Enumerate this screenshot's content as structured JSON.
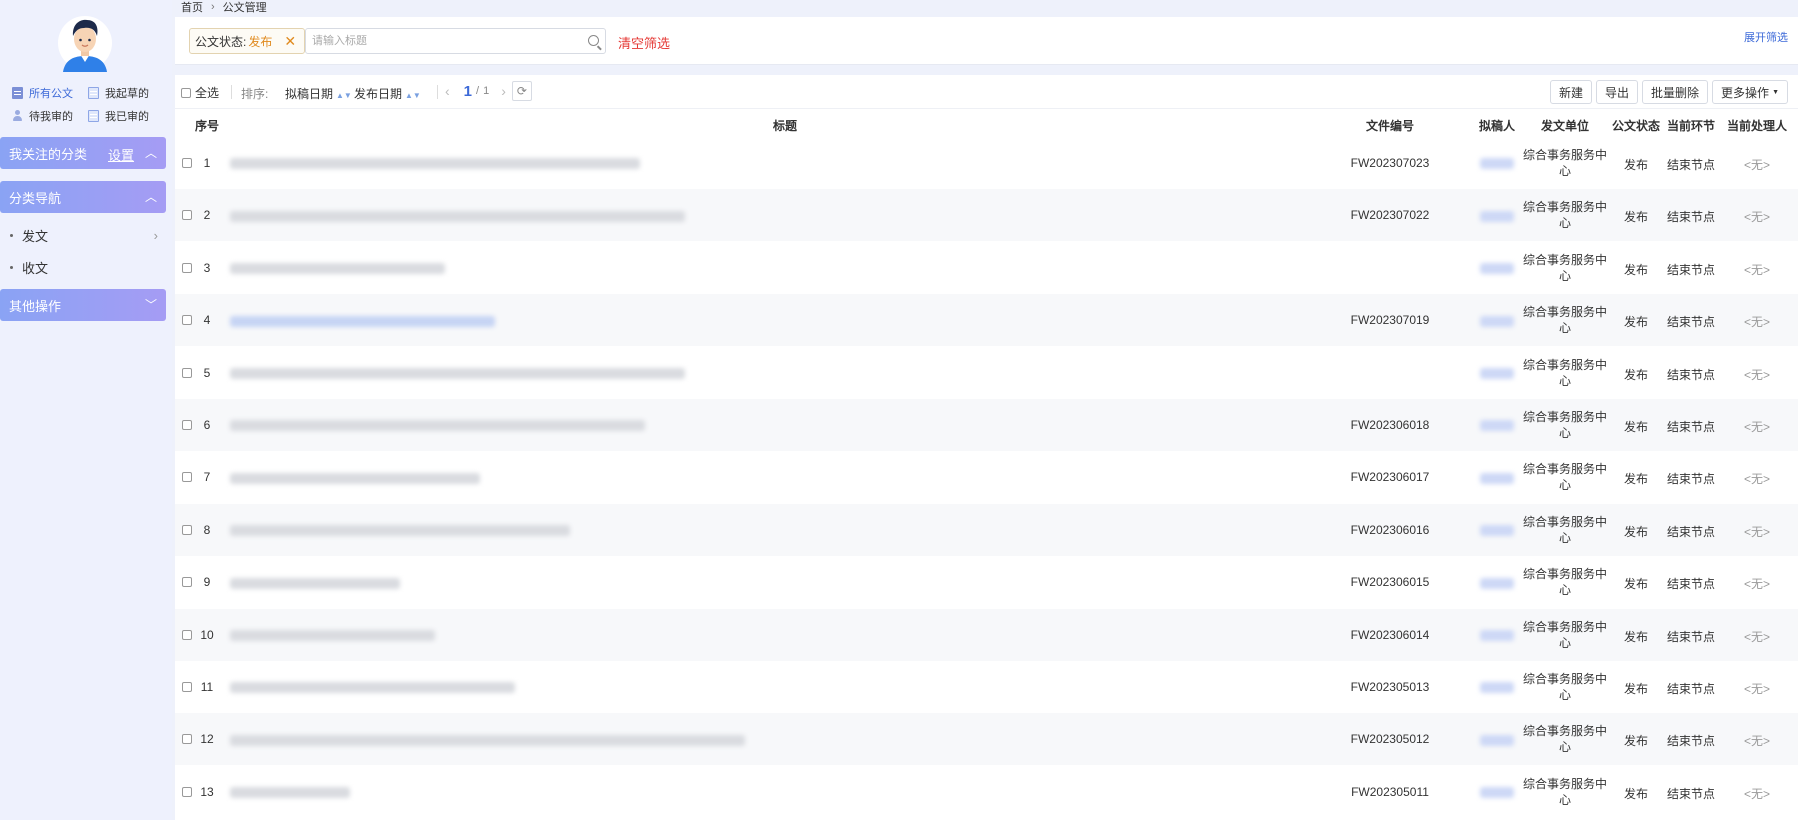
{
  "sidebar": {
    "quick_links": [
      {
        "label": "所有公文",
        "icon": "document-icon"
      },
      {
        "label": "我起草的",
        "icon": "document-icon"
      },
      {
        "label": "待我审的",
        "icon": "user-icon"
      },
      {
        "label": "我已审的",
        "icon": "document-icon"
      }
    ],
    "followed_section": {
      "label": "我关注的分类",
      "settings_label": "设置"
    },
    "category_section": {
      "label": "分类导航",
      "items": [
        {
          "label": "发文"
        },
        {
          "label": "收文"
        }
      ]
    },
    "other_section": {
      "label": "其他操作"
    }
  },
  "breadcrumb": {
    "home": "首页",
    "current": "公文管理"
  },
  "filter": {
    "tag_key": "公文状态:",
    "tag_value": "发布",
    "search_placeholder": "请输入标题",
    "clear_label": "清空筛选",
    "expand_label": "展开筛选"
  },
  "toolbar": {
    "select_all": "全选",
    "sort_label": "排序:",
    "sort_options": [
      "拟稿日期",
      "发布日期"
    ],
    "page_current": "1",
    "page_total": "1",
    "buttons": {
      "new": "新建",
      "export": "导出",
      "batch_delete": "批量删除",
      "more": "更多操作"
    }
  },
  "table": {
    "headers": {
      "no": "序号",
      "title": "标题",
      "code": "文件编号",
      "author": "拟稿人",
      "unit": "发文单位",
      "status": "公文状态",
      "node": "当前环节",
      "handler": "当前处理人"
    },
    "rows": [
      {
        "no": "1",
        "code": "FW202307023",
        "unit": "综合事务服务中心",
        "status": "发布",
        "node": "结束节点",
        "handler": "<无>"
      },
      {
        "no": "2",
        "code": "FW202307022",
        "unit": "综合事务服务中心",
        "status": "发布",
        "node": "结束节点",
        "handler": "<无>"
      },
      {
        "no": "3",
        "code": "",
        "unit": "综合事务服务中心",
        "status": "发布",
        "node": "结束节点",
        "handler": "<无>"
      },
      {
        "no": "4",
        "code": "FW202307019",
        "unit": "综合事务服务中心",
        "status": "发布",
        "node": "结束节点",
        "handler": "<无>"
      },
      {
        "no": "5",
        "code": "",
        "unit": "综合事务服务中心",
        "status": "发布",
        "node": "结束节点",
        "handler": "<无>"
      },
      {
        "no": "6",
        "code": "FW202306018",
        "unit": "综合事务服务中心",
        "status": "发布",
        "node": "结束节点",
        "handler": "<无>"
      },
      {
        "no": "7",
        "code": "FW202306017",
        "unit": "综合事务服务中心",
        "status": "发布",
        "node": "结束节点",
        "handler": "<无>"
      },
      {
        "no": "8",
        "code": "FW202306016",
        "unit": "综合事务服务中心",
        "status": "发布",
        "node": "结束节点",
        "handler": "<无>"
      },
      {
        "no": "9",
        "code": "FW202306015",
        "unit": "综合事务服务中心",
        "status": "发布",
        "node": "结束节点",
        "handler": "<无>"
      },
      {
        "no": "10",
        "code": "FW202306014",
        "unit": "综合事务服务中心",
        "status": "发布",
        "node": "结束节点",
        "handler": "<无>"
      },
      {
        "no": "11",
        "code": "FW202305013",
        "unit": "综合事务服务中心",
        "status": "发布",
        "node": "结束节点",
        "handler": "<无>"
      },
      {
        "no": "12",
        "code": "FW202305012",
        "unit": "综合事务服务中心",
        "status": "发布",
        "node": "结束节点",
        "handler": "<无>"
      },
      {
        "no": "13",
        "code": "FW202305011",
        "unit": "综合事务服务中心",
        "status": "发布",
        "node": "结束节点",
        "handler": "<无>"
      }
    ]
  },
  "colors": {
    "accent": "#3d6ad8",
    "section_header": "#8aa3f4",
    "clear": "#e53935",
    "tag_value": "#e08a1e"
  }
}
